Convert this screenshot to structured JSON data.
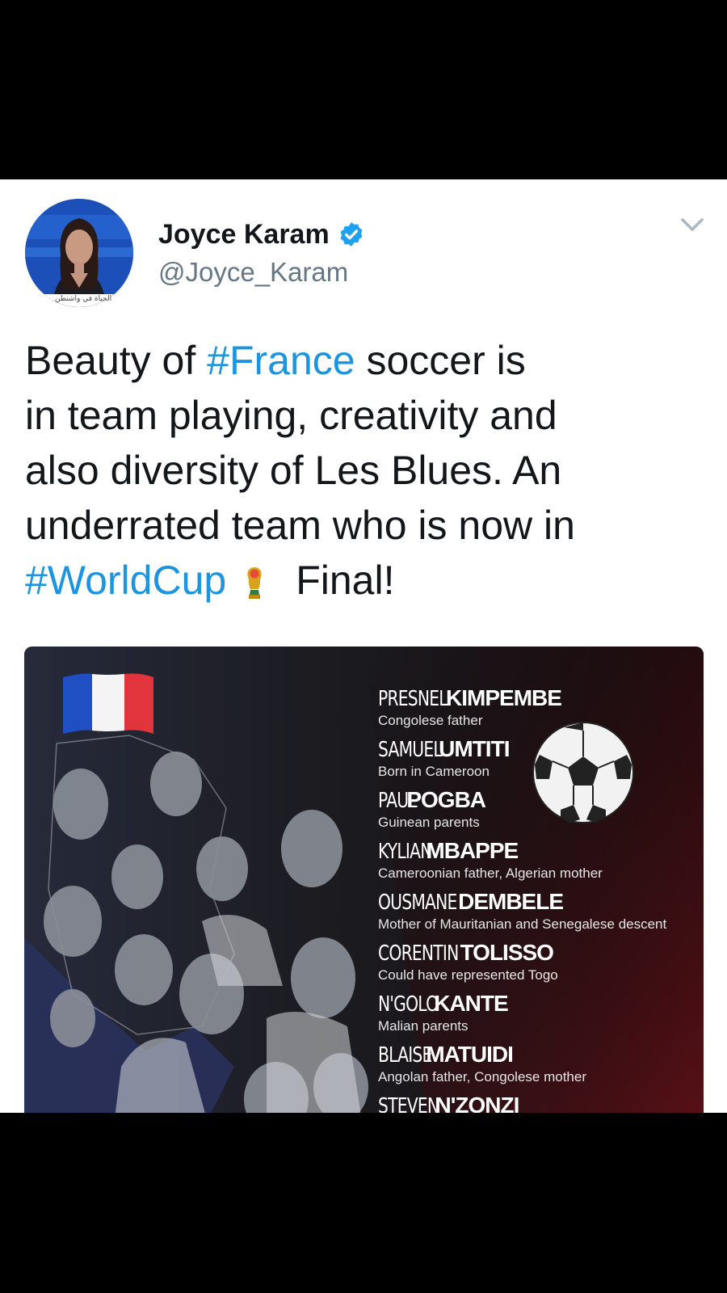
{
  "author": {
    "display_name": "Joyce Karam",
    "handle": "@Joyce_Karam",
    "avatar_caption": "الحياة في واشنطن"
  },
  "icons": {
    "verified": "verified-badge-icon",
    "menu": "chevron-down-icon",
    "emoji": "world-cup-trophy-icon",
    "flag": "france-flag-icon",
    "ball": "soccer-ball-icon"
  },
  "tweet": {
    "line1_pre": "Beauty of ",
    "hashtag_france": "#France",
    "line1_post": " soccer is",
    "line2": "in team playing, creativity and",
    "line3": "also diversity of Les Blues. An",
    "line4": "underrated team who is now in",
    "hashtag_worldcup": "#WorldCup",
    "line5_post": "Final!"
  },
  "media": {
    "players": [
      {
        "first": "PRESNEL",
        "last": "KIMPEMBE",
        "desc": "Congolese father"
      },
      {
        "first": "SAMUEL",
        "last": "UMTITI",
        "desc": "Born in Cameroon"
      },
      {
        "first": "PAUL",
        "last": "POGBA",
        "desc": "Guinean parents"
      },
      {
        "first": "KYLIAN",
        "last": "MBAPPE",
        "desc": "Cameroonian father, Algerian mother"
      },
      {
        "first": "OUSMANE",
        "last": "DEMBELE",
        "desc": "Mother of Mauritanian and Senegalese descent"
      },
      {
        "first": "CORENTIN",
        "last": "TOLISSO",
        "desc": "Could have represented Togo"
      },
      {
        "first": "N'GOLO",
        "last": "KANTE",
        "desc": "Malian parents"
      },
      {
        "first": "BLAISE",
        "last": "MATUIDI",
        "desc": "Angolan father, Congolese mother"
      },
      {
        "first": "STEVEN",
        "last": "N'ZONZI",
        "desc": ""
      }
    ]
  },
  "colors": {
    "hashtag": "#1b95e0",
    "verified": "#1da1f2",
    "handle": "#657786",
    "text": "#14171a"
  }
}
